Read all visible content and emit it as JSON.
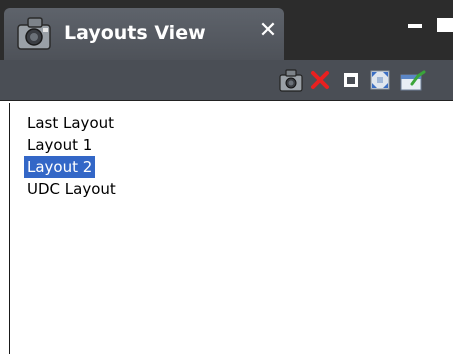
{
  "tab": {
    "title": "Layouts View",
    "close_label": "✕"
  },
  "toolbar": {
    "buttons": [
      {
        "icon": "camera-icon"
      },
      {
        "icon": "delete-x-icon"
      },
      {
        "icon": "window-icon"
      },
      {
        "icon": "fit-view-icon"
      },
      {
        "icon": "save-layout-icon"
      }
    ]
  },
  "layouts": {
    "items": [
      {
        "label": "Last Layout",
        "selected": false
      },
      {
        "label": "Layout 1",
        "selected": false
      },
      {
        "label": "Layout 2",
        "selected": true
      },
      {
        "label": "UDC Layout",
        "selected": false
      }
    ]
  },
  "colors": {
    "selection": "#3367c7",
    "tab_bg": "#55595f",
    "toolbar_bg": "#4a4e55"
  }
}
